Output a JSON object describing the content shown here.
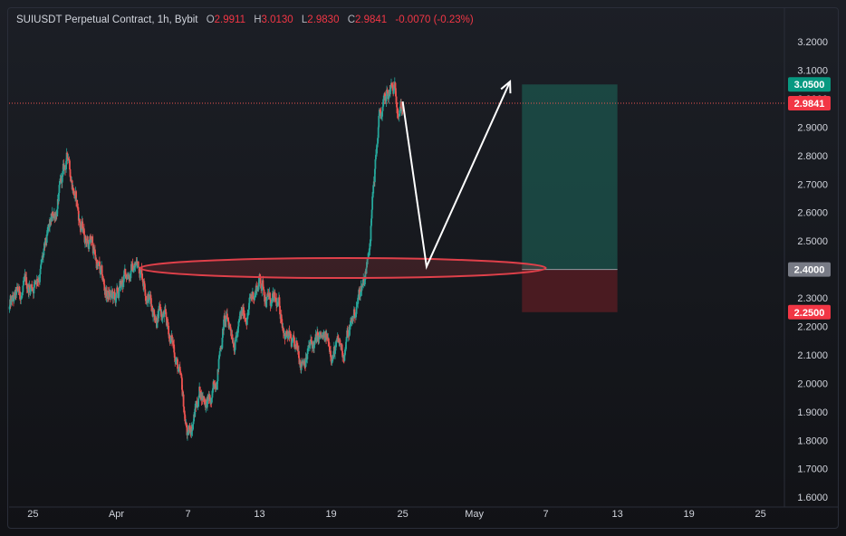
{
  "legend": {
    "symbol": "SUIUSDT Perpetual Contract, 1h, Bybit",
    "open_key": "O",
    "open": "2.9911",
    "high_key": "H",
    "high": "3.0130",
    "low_key": "L",
    "low": "2.9830",
    "close_key": "C",
    "close": "2.9841",
    "change": "-0.0070 (-0.23%)"
  },
  "colors": {
    "up": "#26a69a",
    "down": "#ef5350",
    "background": "#131722",
    "target_zone": "#1e6a5c",
    "stop_zone": "#6e1e25",
    "ellipse": "#e0404a",
    "arrow": "#ffffff",
    "last_price_line": "#ef5350"
  },
  "chart_data": {
    "type": "candlestick",
    "timeframe": "1h",
    "y_axis": {
      "ticks": [
        "3.2000",
        "3.1000",
        "3.0000",
        "2.9000",
        "2.8000",
        "2.7000",
        "2.6000",
        "2.5000",
        "2.4000",
        "2.3000",
        "2.2000",
        "2.1000",
        "2.0000",
        "1.9000",
        "1.8000",
        "1.7000",
        "1.6000"
      ],
      "range": [
        1.59,
        3.22
      ]
    },
    "x_axis": {
      "ticks": [
        "25",
        "Apr",
        "7",
        "13",
        "19",
        "25",
        "May",
        "7",
        "13",
        "19",
        "25"
      ],
      "tick_dates": [
        "03-25",
        "04-01",
        "04-07",
        "04-13",
        "04-19",
        "04-25",
        "05-01",
        "05-07",
        "05-13",
        "05-19",
        "05-25"
      ]
    },
    "x_range": [
      "03-23",
      "05-27"
    ],
    "price_path": [
      {
        "date": "03-23",
        "price": 2.26
      },
      {
        "date": "03-25",
        "price": 2.35
      },
      {
        "date": "03-26",
        "price": 2.45
      },
      {
        "date": "03-27",
        "price": 2.62
      },
      {
        "date": "03-28",
        "price": 2.8
      },
      {
        "date": "03-29",
        "price": 2.55
      },
      {
        "date": "03-30",
        "price": 2.48
      },
      {
        "date": "03-31",
        "price": 2.32
      },
      {
        "date": "04-01",
        "price": 2.28
      },
      {
        "date": "04-02",
        "price": 2.4
      },
      {
        "date": "04-03",
        "price": 2.42
      },
      {
        "date": "04-04",
        "price": 2.28
      },
      {
        "date": "04-05",
        "price": 2.22
      },
      {
        "date": "04-06",
        "price": 2.1
      },
      {
        "date": "04-07",
        "price": 1.8
      },
      {
        "date": "04-08",
        "price": 1.98
      },
      {
        "date": "04-09",
        "price": 1.92
      },
      {
        "date": "04-10",
        "price": 2.22
      },
      {
        "date": "04-11",
        "price": 2.18
      },
      {
        "date": "04-12",
        "price": 2.26
      },
      {
        "date": "04-13",
        "price": 2.37
      },
      {
        "date": "04-14",
        "price": 2.28
      },
      {
        "date": "04-15",
        "price": 2.22
      },
      {
        "date": "04-16",
        "price": 2.08
      },
      {
        "date": "04-17",
        "price": 2.12
      },
      {
        "date": "04-18",
        "price": 2.14
      },
      {
        "date": "04-19",
        "price": 2.13
      },
      {
        "date": "04-20",
        "price": 2.11
      },
      {
        "date": "04-21",
        "price": 2.25
      },
      {
        "date": "04-22",
        "price": 2.42
      },
      {
        "date": "04-23",
        "price": 2.92
      },
      {
        "date": "04-24",
        "price": 3.02
      },
      {
        "date": "04-25",
        "price": 2.984
      }
    ],
    "last_price": {
      "label": "2.9841",
      "value": 2.9841
    },
    "tags": [
      {
        "label": "3.0500",
        "value": 3.05,
        "color": "#089981"
      },
      {
        "label": "2.9841",
        "value": 2.9841,
        "color": "#f23645"
      },
      {
        "label": "2.4000",
        "value": 2.4,
        "color": "#787b86"
      },
      {
        "label": "2.2500",
        "value": 2.25,
        "color": "#f23645"
      }
    ],
    "annotations": {
      "support_ellipse": {
        "from": "04-03",
        "to": "05-07",
        "center": 2.405,
        "half_height": 0.035
      },
      "position": {
        "from": "05-05",
        "to": "05-13",
        "entry": 2.4,
        "target": 3.05,
        "stop": 2.25
      },
      "projection_path": [
        {
          "date": "04-25",
          "price": 2.99
        },
        {
          "date": "04-27",
          "price": 2.41
        },
        {
          "date": "05-04",
          "price": 3.06
        }
      ]
    }
  }
}
